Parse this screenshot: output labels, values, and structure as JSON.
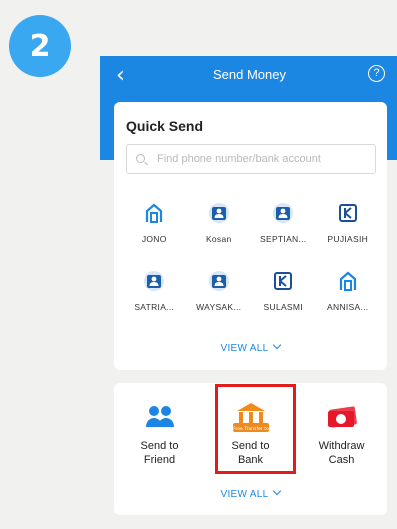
{
  "step": {
    "number": "2"
  },
  "header": {
    "back": "‹",
    "title": "Send Money",
    "help": "?"
  },
  "quick_send": {
    "title": "Quick Send",
    "search_placeholder": "Find phone number/bank account",
    "contacts": [
      {
        "name": "JONO",
        "icon": "bank-logo-icon"
      },
      {
        "name": "Kosan",
        "icon": "user-avatar-icon"
      },
      {
        "name": "SEPTIAN...",
        "icon": "user-avatar-icon"
      },
      {
        "name": "PUJIASIH",
        "icon": "bank-logo-icon"
      },
      {
        "name": "SATRIA...",
        "icon": "user-avatar-icon"
      },
      {
        "name": "WAYSAK...",
        "icon": "user-avatar-icon"
      },
      {
        "name": "SULASMI",
        "icon": "bank-logo-icon"
      },
      {
        "name": "ANNISA...",
        "icon": "bank-logo-icon"
      }
    ],
    "view_all": "VIEW ALL"
  },
  "actions": {
    "items": [
      {
        "label_1": "Send to",
        "label_2": "Friend",
        "icon": "friends-icon"
      },
      {
        "label_1": "Send to",
        "label_2": "Bank",
        "icon": "bank-transfer-icon",
        "badge": "Free Transfer to"
      },
      {
        "label_1": "Withdraw",
        "label_2": "Cash",
        "icon": "cash-icon"
      }
    ],
    "view_all": "VIEW ALL"
  },
  "colors": {
    "primary": "#1c87e3",
    "highlight": "#e21b1b",
    "step_badge": "#3aa8f0"
  }
}
